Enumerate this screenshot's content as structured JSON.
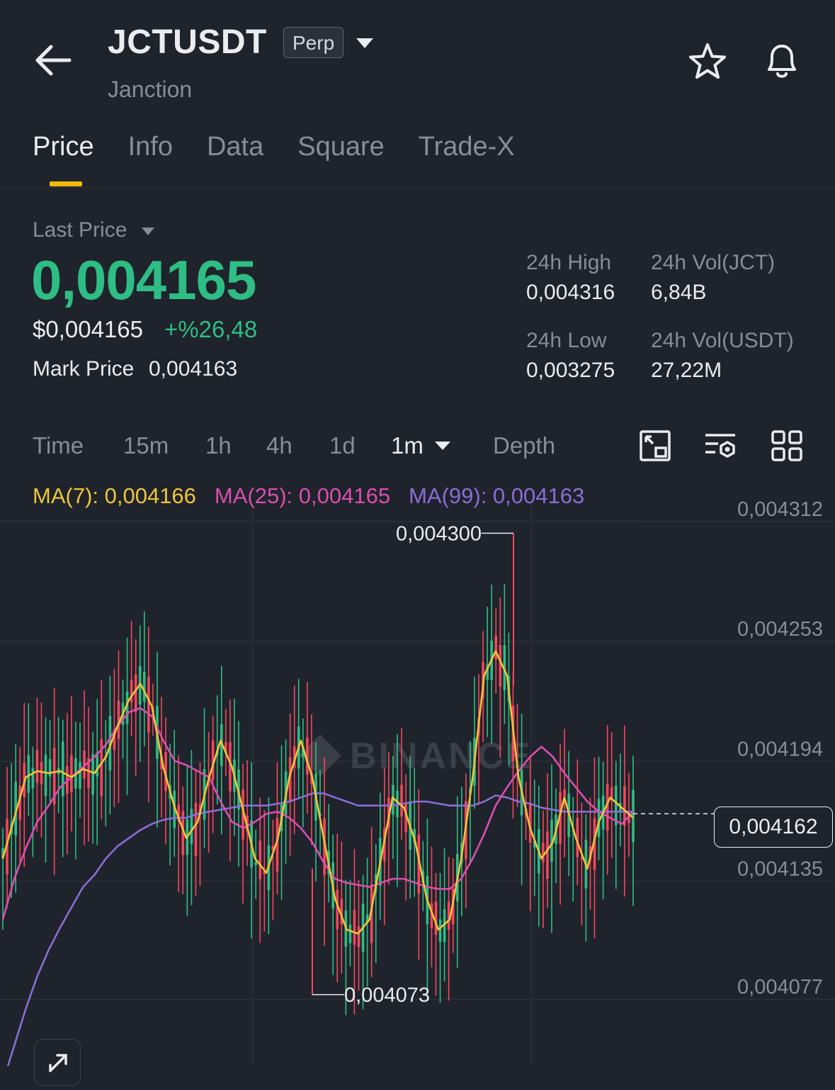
{
  "header": {
    "symbol": "JCTUSDT",
    "contract_badge": "Perp",
    "name": "Janction"
  },
  "tabs": [
    "Price",
    "Info",
    "Data",
    "Square",
    "Trade-X"
  ],
  "active_tab": "Price",
  "price": {
    "label": "Last Price",
    "last": "0,004165",
    "usd": "$0,004165",
    "change": "+%26,48",
    "mark_label": "Mark Price",
    "mark_value": "0,004163"
  },
  "stats": {
    "high_label": "24h High",
    "high_value": "0,004316",
    "low_label": "24h Low",
    "low_value": "0,003275",
    "vol_jct_label": "24h Vol(JCT)",
    "vol_jct_value": "6,84B",
    "vol_usdt_label": "24h Vol(USDT)",
    "vol_usdt_value": "27,22M"
  },
  "timeframes": {
    "items": [
      "Time",
      "15m",
      "1h",
      "4h",
      "1d"
    ],
    "selected": "1m",
    "depth": "Depth"
  },
  "indicators": {
    "ma7": "MA(7): 0,004166",
    "ma25": "MA(25): 0,004165",
    "ma99": "MA(99): 0,004163"
  },
  "chart_data": {
    "type": "candlestick",
    "watermark": "BINANCE",
    "y_ticks": [
      "0,004312",
      "0,004253",
      "0,004194",
      "0,004135",
      "0,004077"
    ],
    "y_tick_values": [
      0.004312,
      0.004253,
      0.004194,
      0.004135,
      0.004077
    ],
    "ylim": [
      0.00403,
      0.00433
    ],
    "annotations": {
      "high": "0,004300",
      "low": "0,004073"
    },
    "current_price": "0,004162",
    "current_price_value": 0.004162,
    "colors": {
      "up": "#2ebd85",
      "down": "#f6465d",
      "ma7": "#f0c53a",
      "ma25": "#d94fb0",
      "ma99": "#8b6dd6"
    },
    "ma7": [
      0.00414,
      0.00416,
      0.00418,
      0.004183,
      0.004182,
      0.004183,
      0.00418,
      0.004184,
      0.004182,
      0.00419,
      0.004205,
      0.004218,
      0.004226,
      0.004215,
      0.004185,
      0.004165,
      0.00415,
      0.004158,
      0.00418,
      0.004198,
      0.004185,
      0.004163,
      0.00414,
      0.004133,
      0.00415,
      0.00418,
      0.004198,
      0.00418,
      0.00415,
      0.00412,
      0.004105,
      0.004103,
      0.00411,
      0.00414,
      0.00417,
      0.004165,
      0.004148,
      0.00412,
      0.004105,
      0.00411,
      0.00414,
      0.00418,
      0.00423,
      0.004242,
      0.00423,
      0.00418,
      0.004155,
      0.00414,
      0.004148,
      0.00417,
      0.00415,
      0.004135,
      0.004158,
      0.00417,
      0.004165,
      0.00416
    ],
    "ma25": [
      0.00411,
      0.00413,
      0.004145,
      0.004158,
      0.004166,
      0.004175,
      0.00418,
      0.004185,
      0.00419,
      0.004196,
      0.004205,
      0.004212,
      0.004214,
      0.00421,
      0.004198,
      0.004188,
      0.004186,
      0.004183,
      0.00418,
      0.004168,
      0.004158,
      0.004155,
      0.004158,
      0.004162,
      0.004163,
      0.00416,
      0.004155,
      0.004148,
      0.004138,
      0.00413,
      0.004128,
      0.004127,
      0.004126,
      0.004128,
      0.00413,
      0.00413,
      0.004128,
      0.004126,
      0.004125,
      0.004125,
      0.00413,
      0.00414,
      0.004152,
      0.004166,
      0.004175,
      0.004183,
      0.00419,
      0.004195,
      0.00419,
      0.004182,
      0.004175,
      0.004168,
      0.004163,
      0.00416,
      0.004157,
      0.004163
    ],
    "ma99": [
      0.00403,
      0.004048,
      0.004066,
      0.004082,
      0.004095,
      0.004106,
      0.004116,
      0.004126,
      0.004132,
      0.00414,
      0.004146,
      0.00415,
      0.004154,
      0.004157,
      0.004159,
      0.00416,
      0.00416,
      0.004162,
      0.004163,
      0.004164,
      0.004165,
      0.004166,
      0.004166,
      0.004166,
      0.004167,
      0.004168,
      0.00417,
      0.004172,
      0.004172,
      0.00417,
      0.004168,
      0.004166,
      0.004166,
      0.004166,
      0.004166,
      0.004167,
      0.004168,
      0.004168,
      0.004167,
      0.004166,
      0.004166,
      0.004166,
      0.004168,
      0.004171,
      0.00417,
      0.004168,
      0.004167,
      0.004165,
      0.004164,
      0.004163,
      0.004163,
      0.004163,
      0.004163,
      0.004163,
      0.004163,
      0.004163
    ]
  }
}
